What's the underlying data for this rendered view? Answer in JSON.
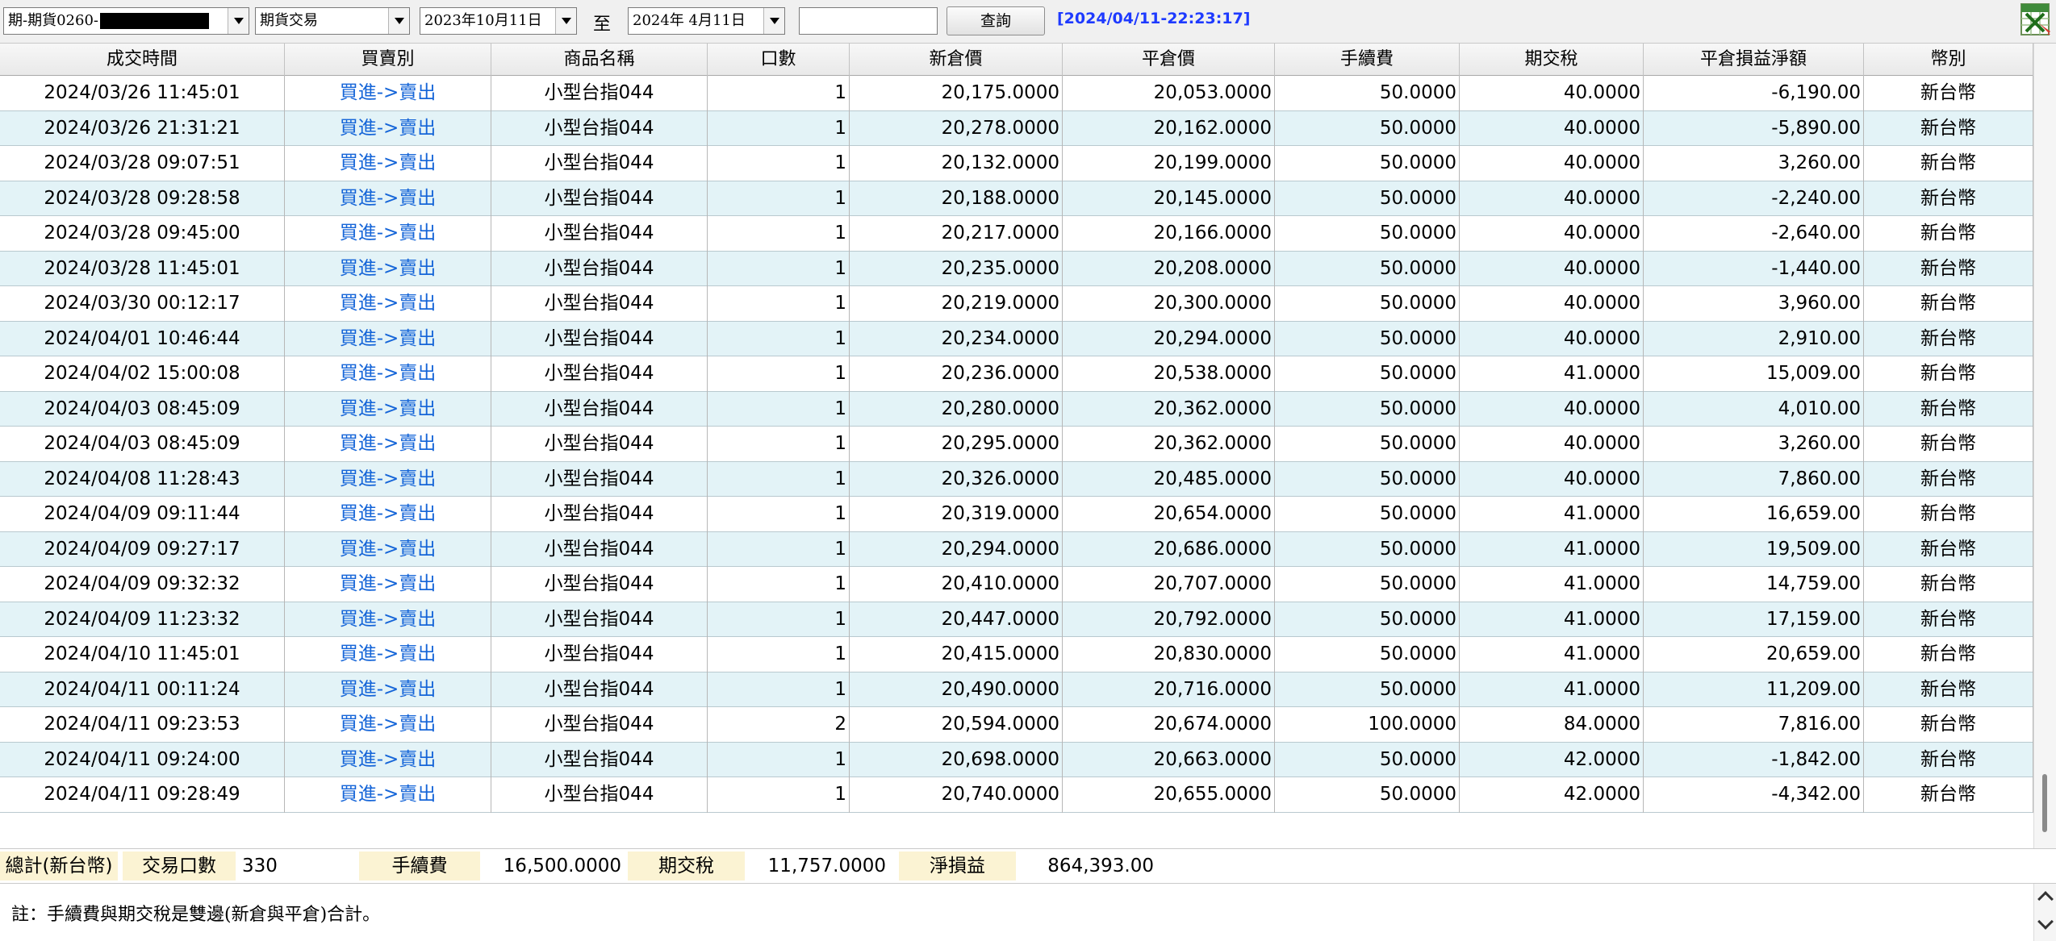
{
  "toolbar": {
    "account_prefix": "期-期貨0260-",
    "trade_type": "期貨交易",
    "date_from": "2023年10月11日",
    "range_sep": "至",
    "date_to": "2024年  4月11日",
    "search_value": "",
    "query_label": "查詢",
    "timestamp": "[2024/04/11-22:23:17]",
    "export_icon": "excel-export-icon"
  },
  "columns": [
    "成交時間",
    "買賣別",
    "商品名稱",
    "口數",
    "新倉價",
    "平倉價",
    "手續費",
    "期交稅",
    "平倉損益淨額",
    "幣別"
  ],
  "rows": [
    [
      "2024/03/26 11:45:01",
      "買進->賣出",
      "小型台指044",
      "1",
      "20,175.0000",
      "20,053.0000",
      "50.0000",
      "40.0000",
      "-6,190.00",
      "新台幣"
    ],
    [
      "2024/03/26 21:31:21",
      "買進->賣出",
      "小型台指044",
      "1",
      "20,278.0000",
      "20,162.0000",
      "50.0000",
      "40.0000",
      "-5,890.00",
      "新台幣"
    ],
    [
      "2024/03/28 09:07:51",
      "買進->賣出",
      "小型台指044",
      "1",
      "20,132.0000",
      "20,199.0000",
      "50.0000",
      "40.0000",
      "3,260.00",
      "新台幣"
    ],
    [
      "2024/03/28 09:28:58",
      "買進->賣出",
      "小型台指044",
      "1",
      "20,188.0000",
      "20,145.0000",
      "50.0000",
      "40.0000",
      "-2,240.00",
      "新台幣"
    ],
    [
      "2024/03/28 09:45:00",
      "買進->賣出",
      "小型台指044",
      "1",
      "20,217.0000",
      "20,166.0000",
      "50.0000",
      "40.0000",
      "-2,640.00",
      "新台幣"
    ],
    [
      "2024/03/28 11:45:01",
      "買進->賣出",
      "小型台指044",
      "1",
      "20,235.0000",
      "20,208.0000",
      "50.0000",
      "40.0000",
      "-1,440.00",
      "新台幣"
    ],
    [
      "2024/03/30 00:12:17",
      "買進->賣出",
      "小型台指044",
      "1",
      "20,219.0000",
      "20,300.0000",
      "50.0000",
      "40.0000",
      "3,960.00",
      "新台幣"
    ],
    [
      "2024/04/01 10:46:44",
      "買進->賣出",
      "小型台指044",
      "1",
      "20,234.0000",
      "20,294.0000",
      "50.0000",
      "40.0000",
      "2,910.00",
      "新台幣"
    ],
    [
      "2024/04/02 15:00:08",
      "買進->賣出",
      "小型台指044",
      "1",
      "20,236.0000",
      "20,538.0000",
      "50.0000",
      "41.0000",
      "15,009.00",
      "新台幣"
    ],
    [
      "2024/04/03 08:45:09",
      "買進->賣出",
      "小型台指044",
      "1",
      "20,280.0000",
      "20,362.0000",
      "50.0000",
      "40.0000",
      "4,010.00",
      "新台幣"
    ],
    [
      "2024/04/03 08:45:09",
      "買進->賣出",
      "小型台指044",
      "1",
      "20,295.0000",
      "20,362.0000",
      "50.0000",
      "40.0000",
      "3,260.00",
      "新台幣"
    ],
    [
      "2024/04/08 11:28:43",
      "買進->賣出",
      "小型台指044",
      "1",
      "20,326.0000",
      "20,485.0000",
      "50.0000",
      "40.0000",
      "7,860.00",
      "新台幣"
    ],
    [
      "2024/04/09 09:11:44",
      "買進->賣出",
      "小型台指044",
      "1",
      "20,319.0000",
      "20,654.0000",
      "50.0000",
      "41.0000",
      "16,659.00",
      "新台幣"
    ],
    [
      "2024/04/09 09:27:17",
      "買進->賣出",
      "小型台指044",
      "1",
      "20,294.0000",
      "20,686.0000",
      "50.0000",
      "41.0000",
      "19,509.00",
      "新台幣"
    ],
    [
      "2024/04/09 09:32:32",
      "買進->賣出",
      "小型台指044",
      "1",
      "20,410.0000",
      "20,707.0000",
      "50.0000",
      "41.0000",
      "14,759.00",
      "新台幣"
    ],
    [
      "2024/04/09 11:23:32",
      "買進->賣出",
      "小型台指044",
      "1",
      "20,447.0000",
      "20,792.0000",
      "50.0000",
      "41.0000",
      "17,159.00",
      "新台幣"
    ],
    [
      "2024/04/10 11:45:01",
      "買進->賣出",
      "小型台指044",
      "1",
      "20,415.0000",
      "20,830.0000",
      "50.0000",
      "41.0000",
      "20,659.00",
      "新台幣"
    ],
    [
      "2024/04/11 00:11:24",
      "買進->賣出",
      "小型台指044",
      "1",
      "20,490.0000",
      "20,716.0000",
      "50.0000",
      "41.0000",
      "11,209.00",
      "新台幣"
    ],
    [
      "2024/04/11 09:23:53",
      "買進->賣出",
      "小型台指044",
      "2",
      "20,594.0000",
      "20,674.0000",
      "100.0000",
      "84.0000",
      "7,816.00",
      "新台幣"
    ],
    [
      "2024/04/11 09:24:00",
      "買進->賣出",
      "小型台指044",
      "1",
      "20,698.0000",
      "20,663.0000",
      "50.0000",
      "42.0000",
      "-1,842.00",
      "新台幣"
    ],
    [
      "2024/04/11 09:28:49",
      "買進->賣出",
      "小型台指044",
      "1",
      "20,740.0000",
      "20,655.0000",
      "50.0000",
      "42.0000",
      "-4,342.00",
      "新台幣"
    ]
  ],
  "summary": {
    "total_label": "總計(新台幣)",
    "lots_label": "交易口數",
    "lots_value": "330",
    "fee_label": "手續費",
    "fee_value": "16,500.0000",
    "tax_label": "期交稅",
    "tax_value": "11,757.0000",
    "net_label": "淨損益",
    "net_value": "864,393.00"
  },
  "note": "註：手續費與期交稅是雙邊(新倉與平倉)合計。",
  "colors": {
    "side_text": "#1565d8",
    "row_alt": "#e3f3f7",
    "summary_label_bg": "#fbf3d3",
    "timestamp": "#1e3aff"
  }
}
